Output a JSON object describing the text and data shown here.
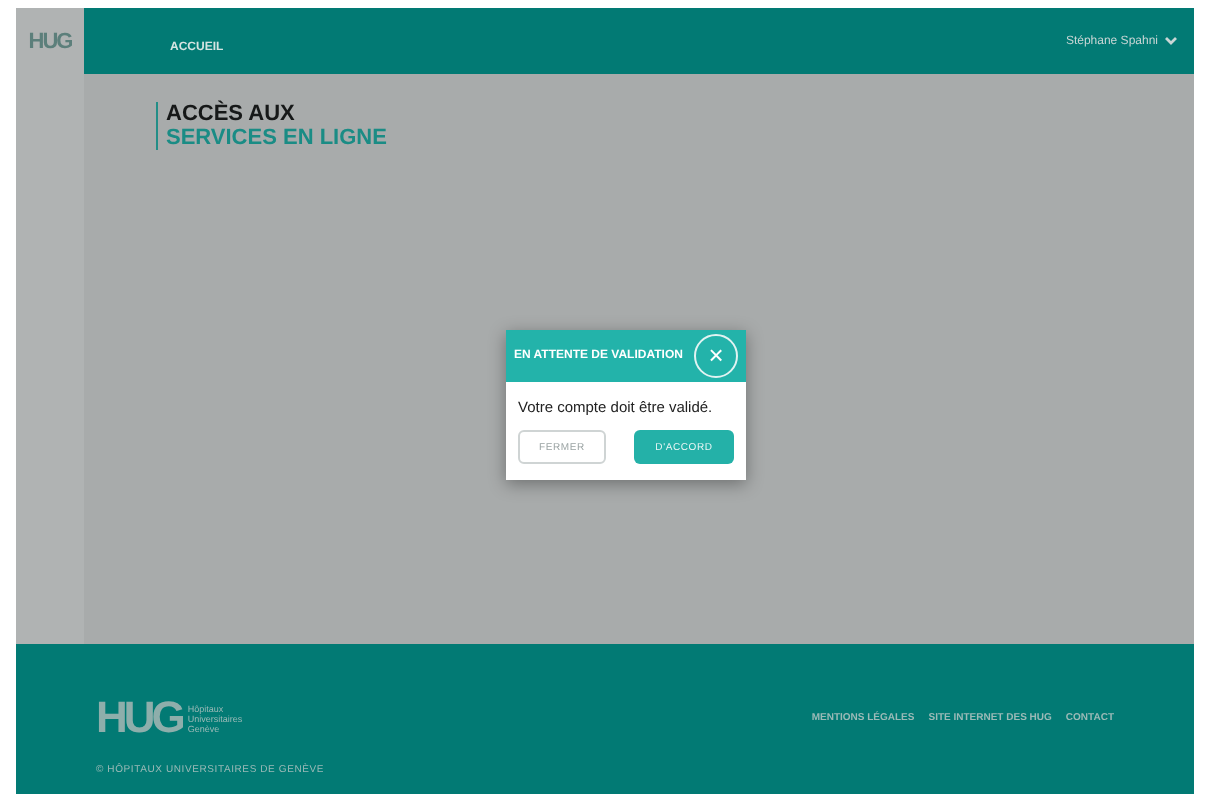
{
  "header": {
    "logo": "HUG",
    "nav": [
      {
        "label": "ACCUEIL",
        "selected": true
      }
    ],
    "user": "Stéphane Spahni"
  },
  "page_title": {
    "line_1": "ACCÈS AUX",
    "line_2": "SERVICES EN LIGNE"
  },
  "dialog": {
    "title": "EN ATTENTE DE VALIDATION",
    "close": "×",
    "message": "Votre compte doit être validé.",
    "buttons": [
      {
        "label": "FERMER",
        "kind": "secondary"
      },
      {
        "label": "D'ACCORD",
        "kind": "primary"
      }
    ]
  },
  "footer": {
    "logo": "HUG",
    "logo_lines": [
      "Hôpitaux",
      "Universitaires",
      "Genève"
    ],
    "links": [
      "MENTIONS LÉGALES",
      "SITE INTERNET DES HUG",
      "CONTACT"
    ],
    "copyright": "© HÔPITAUX UNIVERSITAIRES DE GENÈVE"
  }
}
